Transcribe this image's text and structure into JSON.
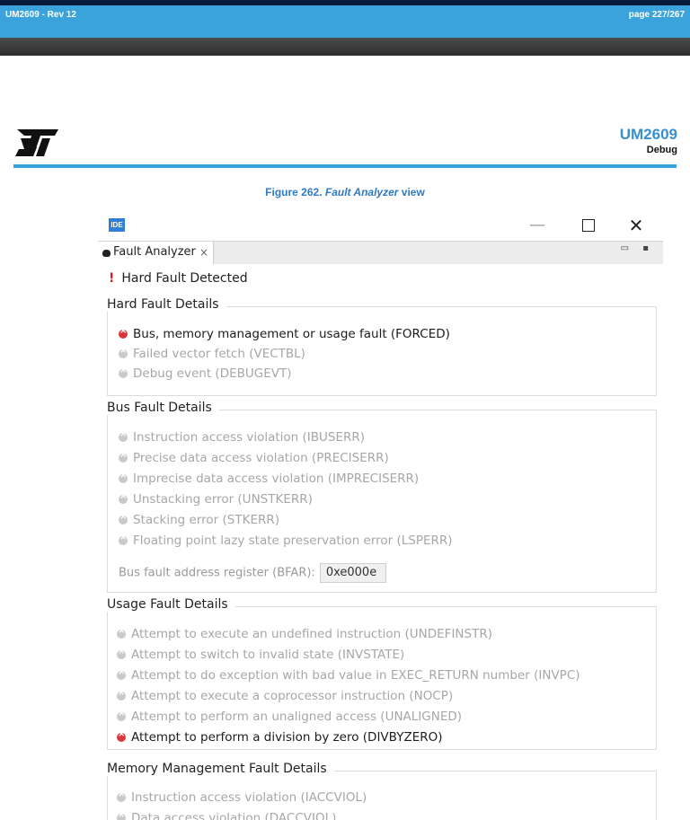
{
  "header": {
    "doc_ref": "UM2609 - Rev 12",
    "page": "page 227/267"
  },
  "doc": {
    "number": "UM2609",
    "section": "Debug"
  },
  "figure": {
    "prefix": "Figure 262. ",
    "title": "Fault Analyzer",
    "suffix": " view"
  },
  "window": {
    "badge": "IDE",
    "minimize": "—",
    "close": "✕"
  },
  "tab": {
    "label": "Fault Analyzer",
    "close": "×",
    "view_buttons": "▭ ▪"
  },
  "status": {
    "icon": "!",
    "text": "Hard Fault Detected",
    "icon_name": "warning-exclamation-icon"
  },
  "hard_fault": {
    "title": "Hard Fault Details",
    "items": [
      {
        "label": "Bus, memory management or usage fault (FORCED)",
        "active": true
      },
      {
        "label": "Failed vector fetch (VECTBL)",
        "active": false
      },
      {
        "label": "Debug event (DEBUGEVT)",
        "active": false
      }
    ]
  },
  "bus_fault": {
    "title": "Bus Fault Details",
    "items": [
      {
        "label": "Instruction access violation (IBUSERR)",
        "active": false
      },
      {
        "label": "Precise data access violation (PRECISERR)",
        "active": false
      },
      {
        "label": "Imprecise data access violation (IMPRECISERR)",
        "active": false
      },
      {
        "label": "Unstacking error (UNSTKERR)",
        "active": false
      },
      {
        "label": "Stacking error (STKERR)",
        "active": false
      },
      {
        "label": "Floating point lazy state preservation error (LSPERR)",
        "active": false
      }
    ],
    "bfar_label": "Bus fault address register (BFAR):",
    "bfar_value": "0xe000e"
  },
  "usage_fault": {
    "title": "Usage Fault Details",
    "items": [
      {
        "label": "Attempt to execute an undefined instruction (UNDEFINSTR)",
        "active": false
      },
      {
        "label": "Attempt to switch to invalid state (INVSTATE)",
        "active": false
      },
      {
        "label": "Attempt to do exception with bad value in EXEC_RETURN number (INVPC)",
        "active": false
      },
      {
        "label": "Attempt to execute a coprocessor instruction (NOCP)",
        "active": false
      },
      {
        "label": "Attempt to perform an unaligned access (UNALIGNED)",
        "active": false
      },
      {
        "label": "Attempt to perform a division by zero (DIVBYZERO)",
        "active": true
      }
    ]
  },
  "mem_fault": {
    "title": "Memory Management Fault Details",
    "items": [
      {
        "label": "Instruction access violation (IACCVIOL)",
        "active": false
      },
      {
        "label": "Data access violation (DACCVIOL)",
        "active": false
      }
    ]
  },
  "colors": {
    "active_icon": "#d9383a",
    "inactive_icon": "#c9c9c9",
    "accent": "#3aa3db",
    "caption": "#2e7ac4"
  }
}
